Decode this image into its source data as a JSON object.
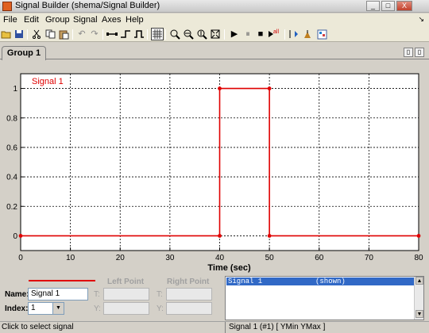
{
  "window": {
    "title": "Signal Builder (shema/Signal Builder)",
    "minimize_glyph": "_",
    "maximize_glyph": "□",
    "close_glyph": "X"
  },
  "menu": {
    "items": [
      "File",
      "Edit",
      "Group",
      "Signal",
      "Axes",
      "Help"
    ],
    "arrow_glyph": "↘"
  },
  "toolbar": {
    "icons": [
      "open-icon",
      "save-icon",
      "cut-icon",
      "copy-icon",
      "paste-icon",
      "undo-icon",
      "redo-icon",
      "line-segment-icon",
      "step-up-icon",
      "step-pulse-icon",
      "grid-icon",
      "zoom-xy-icon",
      "zoom-x-icon",
      "zoom-y-icon",
      "fit-icon",
      "play-icon",
      "pause-icon",
      "stop-icon",
      "run-all-icon",
      "export-icon",
      "help-icon",
      "tile-icon"
    ],
    "undo_glyph": "↶",
    "redo_glyph": "↷",
    "play_glyph": "▶",
    "pause_glyph": "⏸",
    "stop_glyph": "■",
    "run_all_label": "all"
  },
  "tabs": {
    "group_label": "Group 1",
    "nav_glyphs": [
      "▯",
      "▯"
    ]
  },
  "chart_data": {
    "type": "line",
    "series": [
      {
        "name": "Signal 1",
        "x": [
          0,
          40,
          40,
          50,
          50,
          80
        ],
        "y": [
          0,
          0,
          1,
          1,
          0,
          0
        ]
      }
    ],
    "xlabel": "Time (sec)",
    "ylabel": "",
    "xlim": [
      0,
      80
    ],
    "ylim": [
      -0.1,
      1.1
    ],
    "xticks": [
      0,
      10,
      20,
      30,
      40,
      50,
      60,
      70,
      80
    ],
    "yticks": [
      0,
      0.2,
      0.4,
      0.6,
      0.8,
      1
    ],
    "grid": true,
    "color": "#e00000"
  },
  "signal_props": {
    "name_label": "Name:",
    "name_value": "Signal 1",
    "index_label": "Index:",
    "index_value": "1",
    "index_arrow": "▼",
    "left_point_label": "Left Point",
    "right_point_label": "Right Point",
    "t_label": "T:",
    "y_label": "Y:"
  },
  "signal_list": {
    "rows": [
      {
        "name": "Signal 1",
        "state": "(shown)"
      }
    ],
    "up_glyph": "▲",
    "down_glyph": "▼"
  },
  "status": {
    "left": "Click to select signal",
    "right": "Signal 1 (#1)  [ YMin YMax ]"
  }
}
